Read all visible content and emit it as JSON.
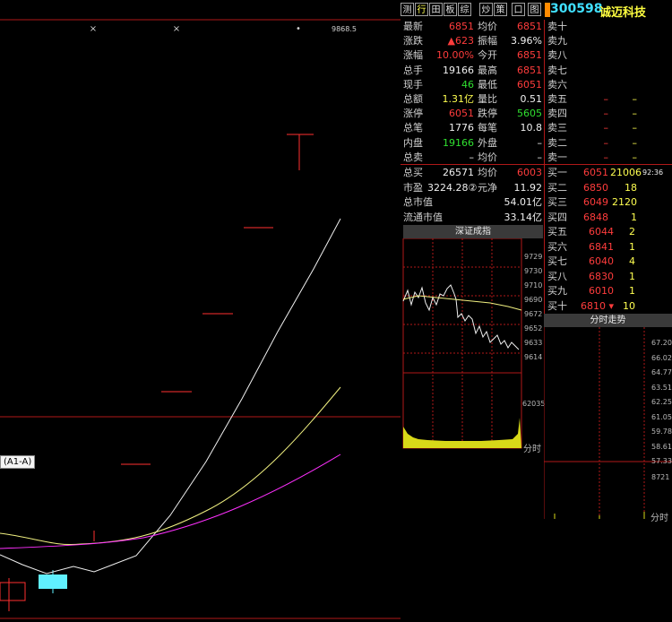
{
  "toolbar": {
    "buttons": [
      "测",
      "行",
      "田",
      "板",
      "综",
      "炒",
      "策",
      "口",
      "图"
    ],
    "flag_color": "#ff8a00",
    "stock_code": "300598",
    "stock_name": "诚迈科技"
  },
  "chart": {
    "top_label": "9868.5",
    "indicator_label": "(A1-A)"
  },
  "quote": {
    "rows": [
      {
        "l1": "最新",
        "v1": "6851",
        "c1": "red",
        "l2": "均价",
        "v2": "6851",
        "c2": "red",
        "l3": "卖十",
        "v3": "",
        "v4": ""
      },
      {
        "l1": "涨跌",
        "v1": "▲623",
        "c1": "red",
        "l2": "振幅",
        "v2": "3.96%",
        "c2": "white",
        "l3": "卖九",
        "v3": "",
        "v4": ""
      },
      {
        "l1": "涨幅",
        "v1": "10.00%",
        "c1": "red",
        "l2": "今开",
        "v2": "6851",
        "c2": "red",
        "l3": "卖八",
        "v3": "",
        "v4": ""
      },
      {
        "l1": "总手",
        "v1": "19166",
        "c1": "white",
        "l2": "最高",
        "v2": "6851",
        "c2": "red",
        "l3": "卖七",
        "v3": "",
        "v4": ""
      },
      {
        "l1": "现手",
        "v1": "46",
        "c1": "green",
        "l2": "最低",
        "v2": "6051",
        "c2": "red",
        "l3": "卖六",
        "v3": "",
        "v4": ""
      },
      {
        "l1": "总额",
        "v1": "1.31亿",
        "c1": "yellow",
        "l2": "量比",
        "v2": "0.51",
        "c2": "white",
        "l3": "卖五",
        "v3": "–",
        "v4": "–"
      },
      {
        "l1": "涨停",
        "v1": "6051",
        "c1": "red",
        "l2": "跌停",
        "v2": "5605",
        "c2": "green",
        "l3": "卖四",
        "v3": "–",
        "v4": "–"
      },
      {
        "l1": "总笔",
        "v1": "1776",
        "c1": "white",
        "l2": "每笔",
        "v2": "10.8",
        "c2": "white",
        "l3": "卖三",
        "v3": "–",
        "v4": "–"
      },
      {
        "l1": "内盘",
        "v1": "19166",
        "c1": "green",
        "l2": "外盘",
        "v2": "–",
        "c2": "white",
        "l3": "卖二",
        "v3": "–",
        "v4": "–"
      },
      {
        "l1": "总卖",
        "v1": "–",
        "c1": "white",
        "l2": "均价",
        "v2": "–",
        "c2": "white",
        "l3": "卖一",
        "v3": "–",
        "v4": "–"
      }
    ],
    "buy_rows": [
      {
        "l1": "总买",
        "v1": "26571",
        "c1": "white",
        "l2": "均价",
        "v2": "6003",
        "c2": "red",
        "l3": "买一",
        "v3": "6051",
        "v4": "21006",
        "extra": "92:36"
      },
      {
        "l1": "市盈",
        "v1": "3224.28②",
        "c1": "white",
        "l2": "元净",
        "v2": "11.92",
        "c2": "white",
        "l3": "买二",
        "v3": "6850",
        "v4": "18"
      },
      {
        "l1": "总市值",
        "v1": "",
        "c1": "white",
        "l2": "",
        "v2": "54.01亿",
        "c2": "white",
        "l3": "买三",
        "v3": "6049",
        "v4": "2120"
      },
      {
        "l1": "流通市值",
        "v1": "",
        "c1": "white",
        "l2": "",
        "v2": "33.14亿",
        "c2": "white",
        "l3": "买四",
        "v3": "6848",
        "v4": "1"
      }
    ],
    "depth_rows": [
      {
        "l3": "买五",
        "v3": "6044",
        "v4": "2"
      },
      {
        "l3": "买六",
        "v3": "6841",
        "v4": "1"
      },
      {
        "l3": "买七",
        "v3": "6040",
        "v4": "4"
      },
      {
        "l3": "买八",
        "v3": "6830",
        "v4": "1"
      },
      {
        "l3": "买九",
        "v3": "6010",
        "v4": "1"
      },
      {
        "l3": "买十",
        "v3": "6810 ▾",
        "v4": "10"
      }
    ]
  },
  "index_panel": {
    "title": "深证成指",
    "ticks": [
      "9729",
      "9730",
      "9710",
      "9690",
      "9672",
      "9652",
      "9633",
      "9614"
    ],
    "vol_tick": "62035",
    "time_label": "分时"
  },
  "ts_panel": {
    "title": "分时走势",
    "ticks": [
      "67.20",
      "66.02",
      "64.77",
      "63.51",
      "62.25",
      "61.05",
      "59.78",
      "58.61",
      "57.33"
    ],
    "vol_tick": "8721",
    "time_label": "分时"
  }
}
